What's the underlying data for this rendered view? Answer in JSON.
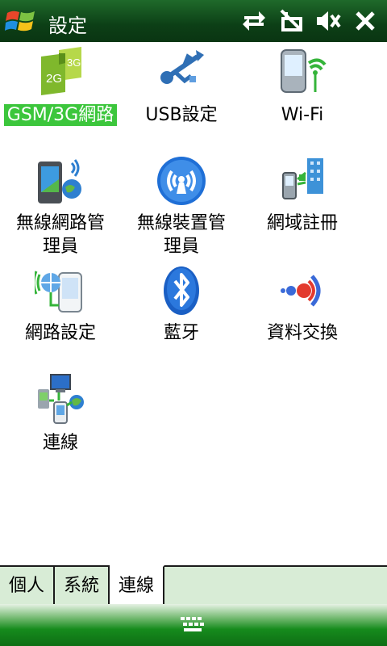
{
  "window": {
    "title": "設定"
  },
  "status_icons": [
    "connectivity-icon",
    "signal-off-icon",
    "volume-mute-icon",
    "close-icon"
  ],
  "items": [
    {
      "label": "GSM/3G網路",
      "icon": "gsm-3g-icon",
      "selected": true
    },
    {
      "label": "USB設定",
      "icon": "usb-icon"
    },
    {
      "label": "Wi-Fi",
      "icon": "wifi-device-icon"
    },
    {
      "label_line1": "無線網路管",
      "label_line2": "理員",
      "icon": "wireless-manager-icon"
    },
    {
      "label_line1": "無線裝置管",
      "label_line2": "理員",
      "icon": "wireless-device-manager-icon"
    },
    {
      "label": "網域註冊",
      "icon": "domain-enroll-icon"
    },
    {
      "label": "網路設定",
      "icon": "network-settings-icon"
    },
    {
      "label": "藍牙",
      "icon": "bluetooth-icon"
    },
    {
      "label": "資料交換",
      "icon": "beam-icon"
    },
    {
      "label": "連線",
      "icon": "connections-icon"
    }
  ],
  "tabs": [
    {
      "label": "個人",
      "active": false
    },
    {
      "label": "系統",
      "active": false
    },
    {
      "label": "連線",
      "active": true
    }
  ],
  "softbar": {
    "icon": "keyboard-icon"
  }
}
